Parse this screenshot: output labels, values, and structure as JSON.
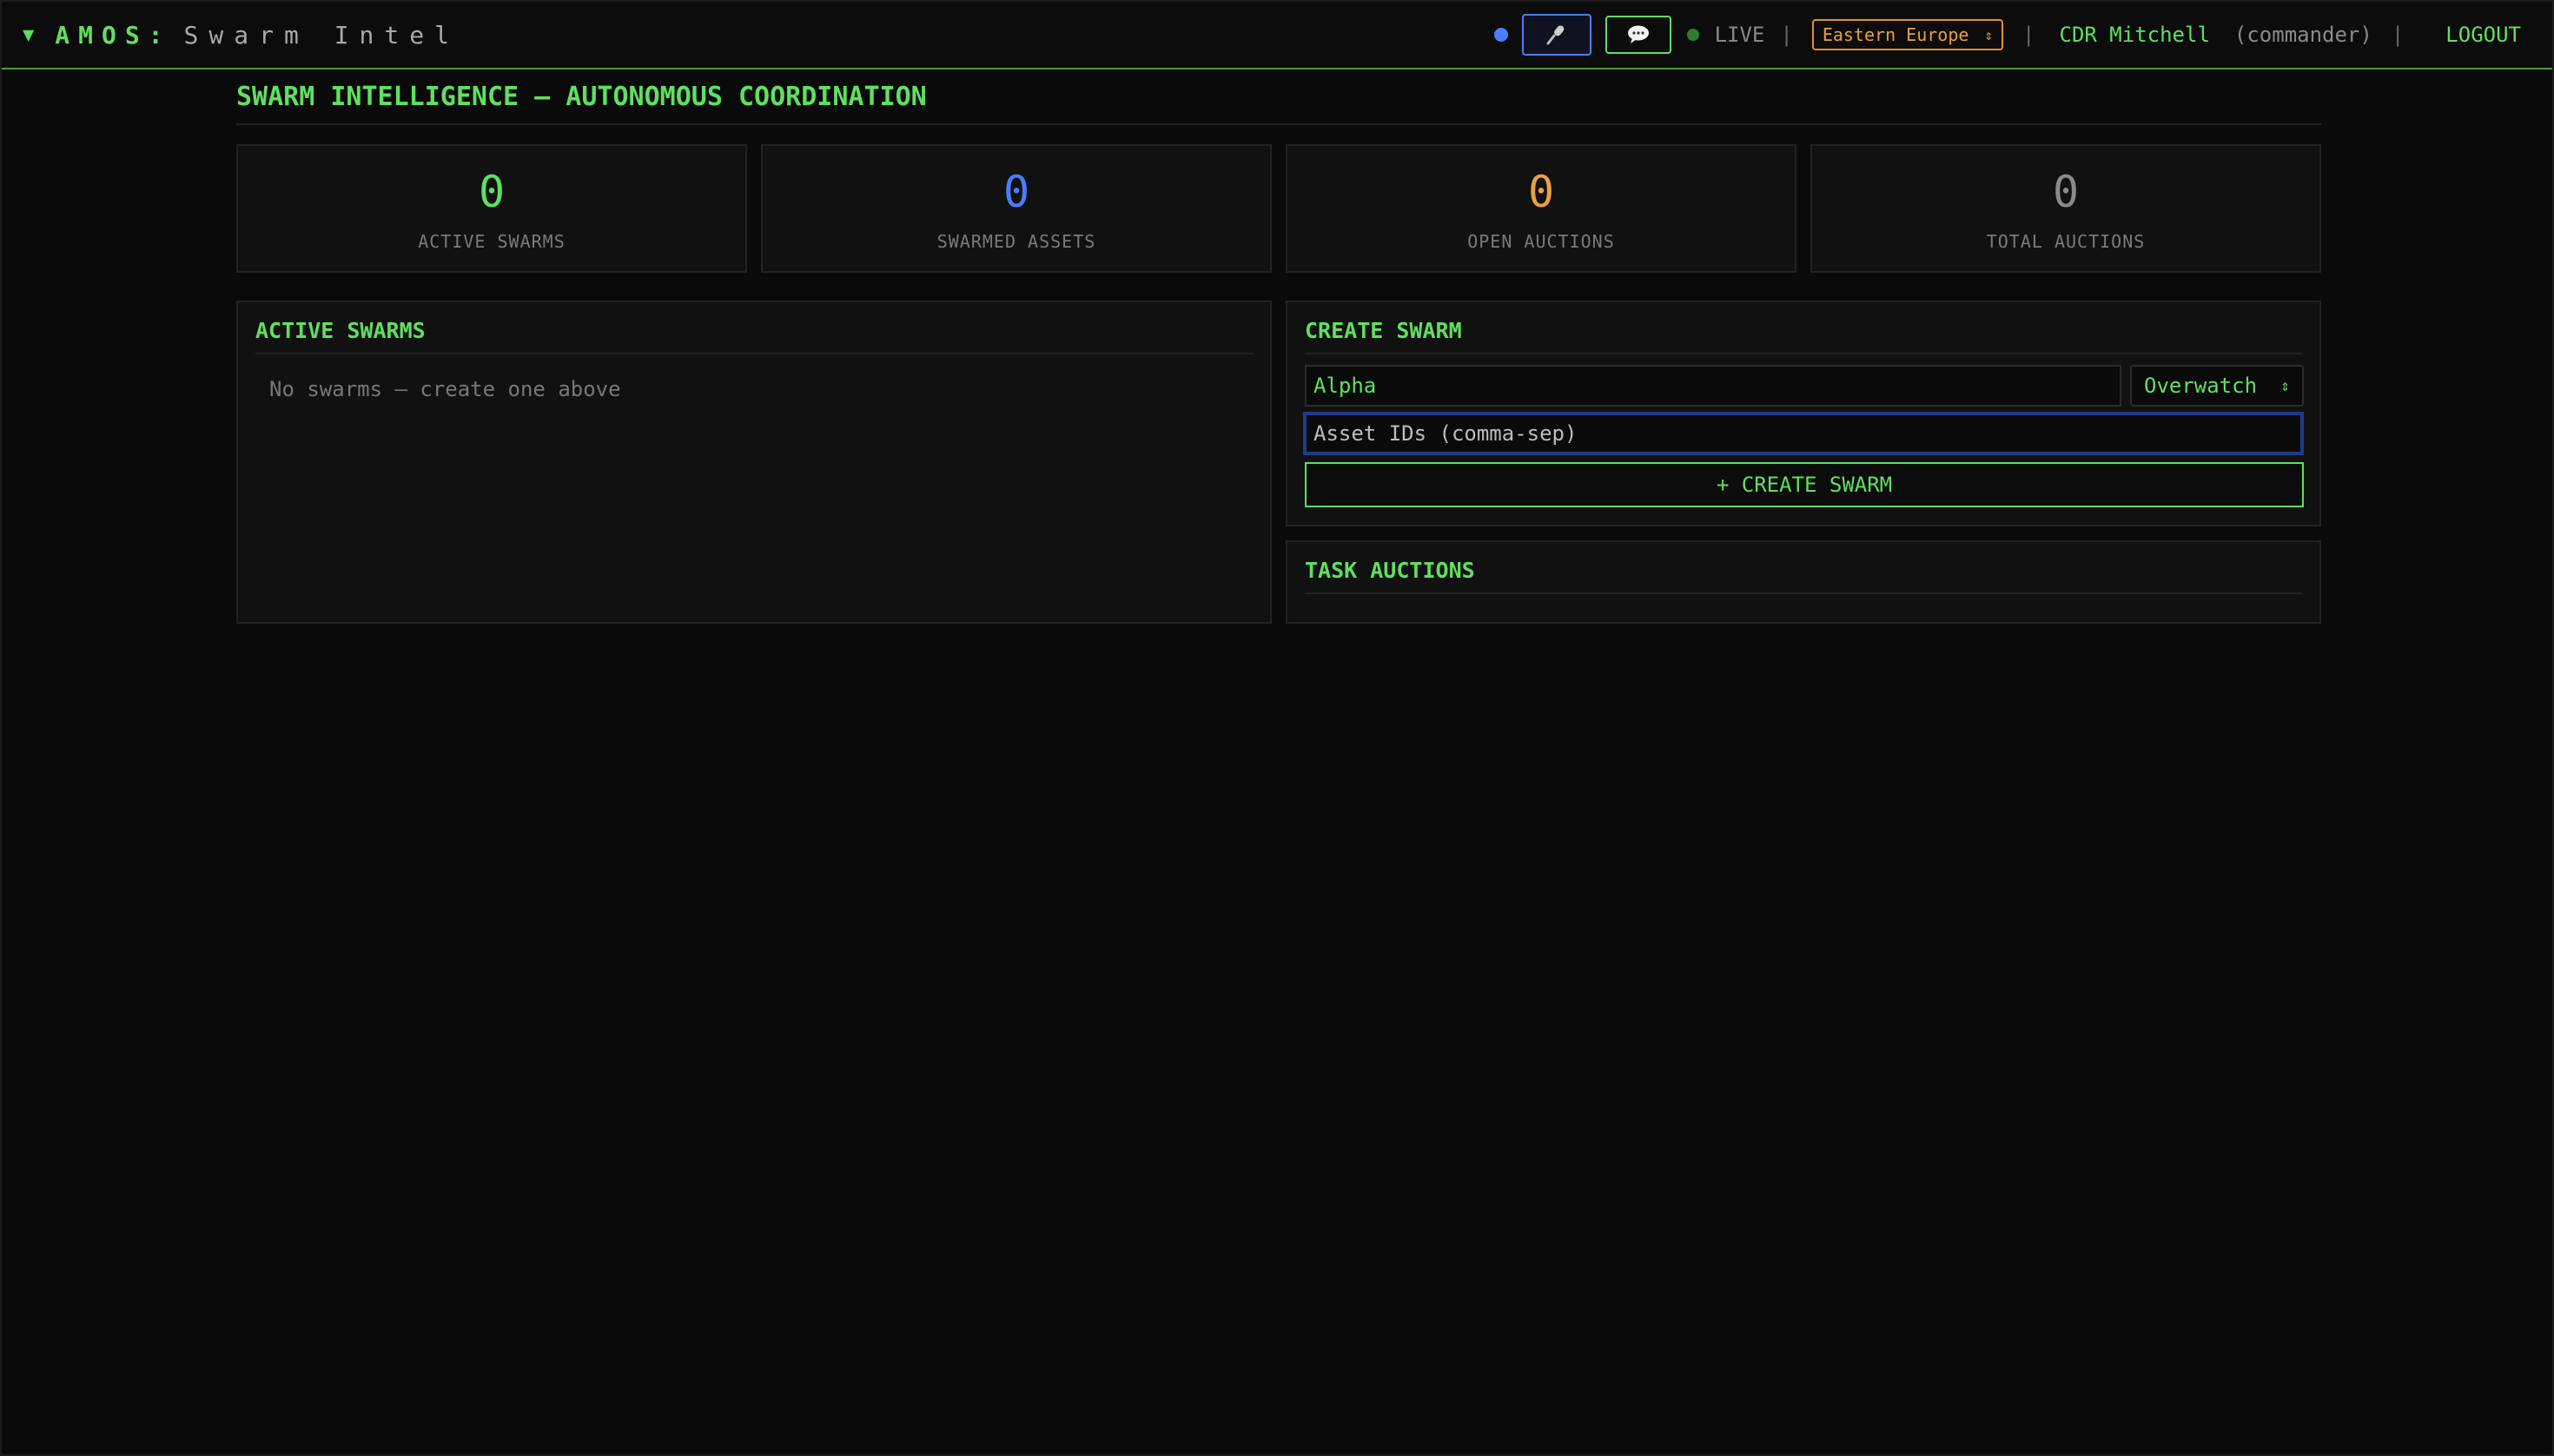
{
  "header": {
    "caret": "▼",
    "app_name": "AMOS:",
    "page_name": "Swarm Intel",
    "live_label": "LIVE",
    "separator": "|",
    "region_value": "Eastern Europe",
    "user_name": "CDR Mitchell",
    "user_role": "(commander)",
    "logout_label": "LOGOUT",
    "icons": [
      "status-dot-icon",
      "microphone-icon",
      "chat-bubble-icon",
      "live-dot-icon",
      "select-arrows-icon"
    ]
  },
  "page": {
    "title": "SWARM INTELLIGENCE — AUTONOMOUS COORDINATION"
  },
  "stats": [
    {
      "value": "0",
      "label": "ACTIVE SWARMS",
      "color": "#5fe05f"
    },
    {
      "value": "0",
      "label": "SWARMED ASSETS",
      "color": "#4a7dff"
    },
    {
      "value": "0",
      "label": "OPEN AUCTIONS",
      "color": "#e8a040"
    },
    {
      "value": "0",
      "label": "TOTAL AUCTIONS",
      "color": "#8a8a8a"
    }
  ],
  "active_swarms": {
    "heading": "ACTIVE SWARMS",
    "empty_text": "No swarms — create one above"
  },
  "create_swarm": {
    "heading": "CREATE SWARM",
    "name_value": "Alpha",
    "mode_value": "Overwatch",
    "assets_placeholder": "Asset IDs (comma-sep)",
    "submit_label": "+ CREATE SWARM"
  },
  "task_auctions": {
    "heading": "TASK AUCTIONS"
  },
  "colors": {
    "accent": "#5fe05f",
    "blue": "#4a7dff",
    "orange": "#e8a040",
    "muted": "#8a8a8a",
    "background": "#0a0a0a"
  }
}
